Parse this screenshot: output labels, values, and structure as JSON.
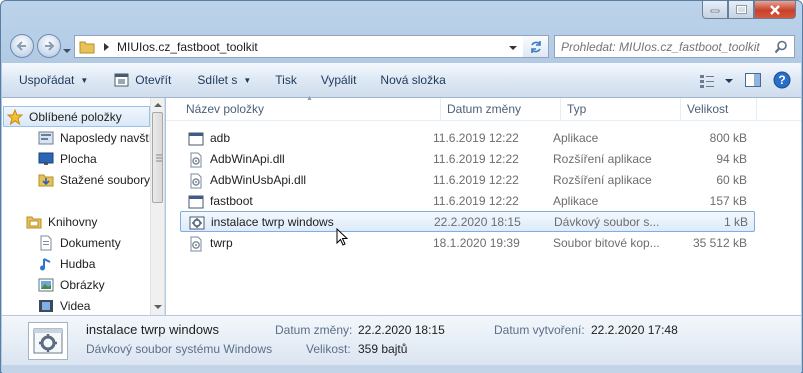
{
  "window": {
    "controls": [
      "minimize-icon",
      "maximize-icon",
      "close-icon"
    ]
  },
  "address": {
    "path": "MIUIos.cz_fastboot_toolkit",
    "search_placeholder": "Prohledat: MIUIos.cz_fastboot_toolkit"
  },
  "toolbar": {
    "organize": "Uspořádat",
    "open": "Otevřít",
    "share": "Sdílet s",
    "print": "Tisk",
    "burn": "Vypálit",
    "new_folder": "Nová složka"
  },
  "nav": {
    "favorites": "Oblíbené položky",
    "recent": "Naposledy navští",
    "desktop": "Plocha",
    "downloads": "Stažené soubory",
    "libraries": "Knihovny",
    "documents": "Dokumenty",
    "music": "Hudba",
    "pictures": "Obrázky",
    "videos": "Videa"
  },
  "columns": {
    "name": "Název položky",
    "date": "Datum změny",
    "type": "Typ",
    "size": "Velikost"
  },
  "files": [
    {
      "name": "adb",
      "date": "11.6.2019 12:22",
      "type": "Aplikace",
      "size": "800 kB",
      "icon": "app-icon"
    },
    {
      "name": "AdbWinApi.dll",
      "date": "11.6.2019 12:22",
      "type": "Rozšíření aplikace",
      "size": "94 kB",
      "icon": "dll-icon"
    },
    {
      "name": "AdbWinUsbApi.dll",
      "date": "11.6.2019 12:22",
      "type": "Rozšíření aplikace",
      "size": "60 kB",
      "icon": "dll-icon"
    },
    {
      "name": "fastboot",
      "date": "11.6.2019 12:22",
      "type": "Aplikace",
      "size": "157 kB",
      "icon": "app-icon"
    },
    {
      "name": "instalace twrp windows",
      "date": "22.2.2020 18:15",
      "type": "Dávkový soubor s...",
      "size": "1 kB",
      "icon": "batch-icon"
    },
    {
      "name": "twrp",
      "date": "18.1.2020 19:39",
      "type": "Soubor bitové kop...",
      "size": "35 512 kB",
      "icon": "image-file-icon"
    }
  ],
  "details": {
    "name": "instalace twrp windows",
    "type": "Dávkový soubor systému Windows",
    "modified_label": "Datum změny:",
    "modified_value": "22.2.2020 18:15",
    "created_label": "Datum vytvoření:",
    "created_value": "22.2.2020 17:48",
    "size_label": "Velikost:",
    "size_value": "359 bajtů"
  },
  "colors": {
    "frame": "#b6cde6",
    "selection": "#dcebfc",
    "toolbar_text": "#1e395b"
  }
}
